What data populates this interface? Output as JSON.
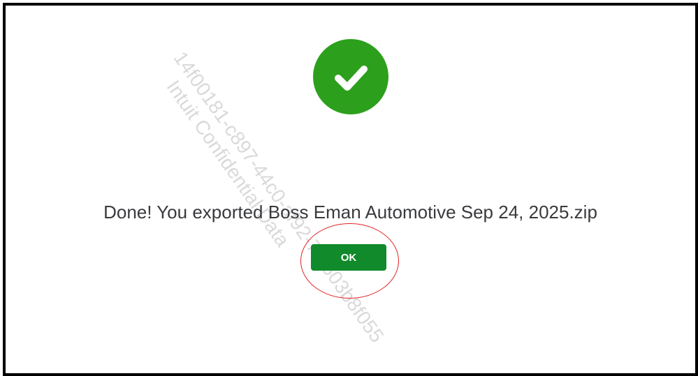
{
  "dialog": {
    "message": "Done! You exported Boss Eman Automotive Sep 24, 2025.zip",
    "ok_label": "OK",
    "status_icon": "checkmark-icon",
    "colors": {
      "success_green": "#2ca01c",
      "button_green": "#108a2a",
      "text": "#393a3d",
      "annotation_red": "#e02020"
    }
  },
  "watermark": {
    "line1": "14f00181-c897-44c0-af92-7f8603b8f055",
    "line2": "Intuit Confidential Data"
  }
}
